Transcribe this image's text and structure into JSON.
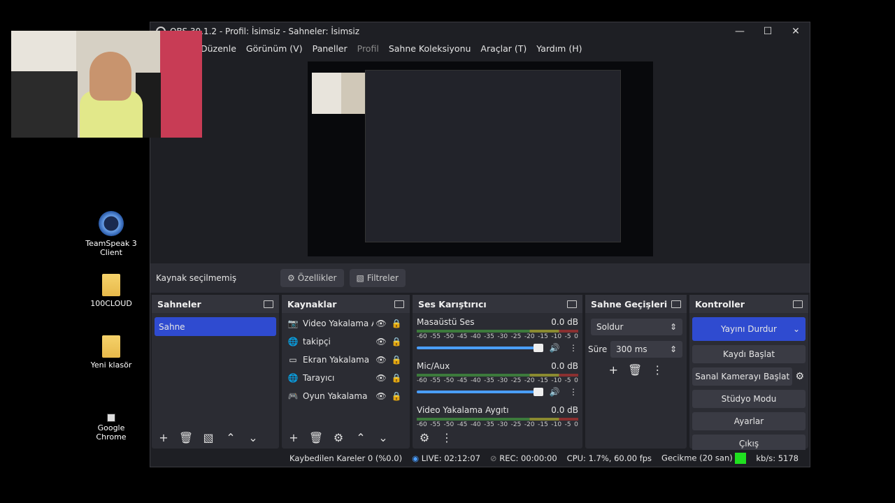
{
  "window": {
    "title": "OBS 30.1.2 - Profil: İsimsiz - Sahneler: İsimsiz",
    "minimize": "—",
    "maximize": "☐",
    "close": "✕"
  },
  "desktop": {
    "icons": [
      {
        "label": "TeamSpeak 3 Client"
      },
      {
        "label": "100CLOUD"
      },
      {
        "label": "Yeni klasör"
      },
      {
        "label": "Google Chrome"
      }
    ]
  },
  "menu": {
    "items": [
      "Düzenle",
      "Görünüm (V)",
      "Paneller",
      "Profil",
      "Sahne Koleksiyonu",
      "Araçlar (T)",
      "Yardım (H)"
    ]
  },
  "source_bar": {
    "label": "Kaynak seçilmemiş",
    "properties": "Özellikler",
    "filters": "Filtreler"
  },
  "scenes": {
    "title": "Sahneler",
    "items": [
      "Sahne"
    ]
  },
  "sources": {
    "title": "Kaynaklar",
    "items": [
      {
        "name": "Video Yakalama Aygıtı",
        "icon": "camera-icon"
      },
      {
        "name": "takipçi",
        "icon": "globe-icon"
      },
      {
        "name": "Ekran Yakalama",
        "icon": "monitor-icon"
      },
      {
        "name": "Tarayıcı",
        "icon": "globe-icon"
      },
      {
        "name": "Oyun Yakalama",
        "icon": "gamepad-icon"
      }
    ]
  },
  "mixer": {
    "title": "Ses Karıştırıcı",
    "scale": [
      "-60",
      "-55",
      "-50",
      "-45",
      "-40",
      "-35",
      "-30",
      "-25",
      "-20",
      "-15",
      "-10",
      "-5",
      "0"
    ],
    "channels": [
      {
        "name": "Masaüstü Ses",
        "level": "0.0 dB"
      },
      {
        "name": "Mic/Aux",
        "level": "0.0 dB"
      },
      {
        "name": "Video Yakalama Aygıtı",
        "level": "0.0 dB"
      }
    ]
  },
  "transitions": {
    "title": "Sahne Geçişleri",
    "type": "Soldur",
    "duration_label": "Süre",
    "duration": "300 ms"
  },
  "controls": {
    "title": "Kontroller",
    "stop_stream": "Yayını Durdur",
    "start_record": "Kaydı Başlat",
    "virtual_cam": "Sanal Kamerayı Başlat",
    "studio_mode": "Stüdyo Modu",
    "settings": "Ayarlar",
    "exit": "Çıkış"
  },
  "status": {
    "dropped": "Kaybedilen Kareler 0 (%0.0)",
    "live": "LIVE: 02:12:07",
    "rec": "REC: 00:00:00",
    "cpu": "CPU: 1.7%, 60.00 fps",
    "delay": "Gecikme (20 san)",
    "bitrate": "kb/s: 5178",
    "indicator_color": "#20e020"
  },
  "colors": {
    "accent": "#2f4bd0",
    "dock_bg": "#2b2c33",
    "window_bg": "#1e1f24"
  }
}
